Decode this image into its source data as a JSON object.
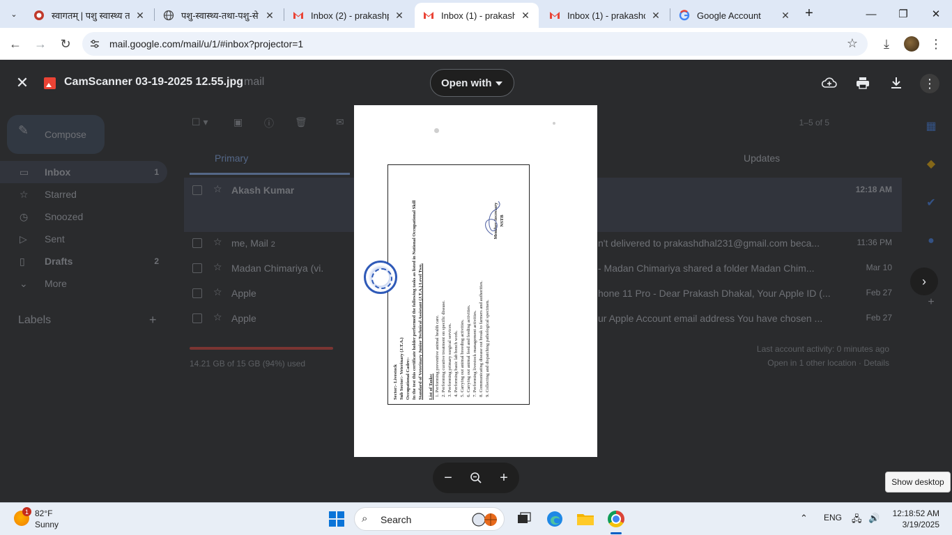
{
  "tabs": [
    {
      "title": "स्वागतम् | पशु स्वास्थ्य त"
    },
    {
      "title": "पशु-स्वास्थ्य-तथा-पशु-से"
    },
    {
      "title": "Inbox (2) - prakashpa"
    },
    {
      "title": "Inbox (1) - prakashdh"
    },
    {
      "title": "Inbox (1) - prakashdh"
    },
    {
      "title": "Google Account"
    }
  ],
  "address": {
    "url": "mail.google.com/mail/u/1/#inbox?projector=1"
  },
  "viewer": {
    "filename": "CamScanner 03-19-2025 12.55.jpg",
    "open_with": "Open with"
  },
  "gmail": {
    "compose": "Compose",
    "nav": [
      {
        "label": "Inbox",
        "count": "1"
      },
      {
        "label": "Starred",
        "count": ""
      },
      {
        "label": "Snoozed",
        "count": ""
      },
      {
        "label": "Sent",
        "count": ""
      },
      {
        "label": "Drafts",
        "count": "2"
      },
      {
        "label": "More",
        "count": ""
      }
    ],
    "labels_heading": "Labels",
    "search_hint": "mail",
    "pager": "1–5 of 5",
    "tab_primary": "Primary",
    "tab_updates": "Updates",
    "rows": [
      {
        "sender": "Akash Kumar",
        "count": "",
        "snippet": "",
        "date": "12:18 AM"
      },
      {
        "sender": "me, Mail",
        "count": "2",
        "snippet": "n't delivered to prakashdhal231@gmail.com beca...",
        "date": "11:36 PM"
      },
      {
        "sender": "Madan Chimariya (vi.",
        "count": "",
        "snippet": "- Madan Chimariya shared a folder Madan Chim...",
        "date": "Mar 10"
      },
      {
        "sender": "Apple",
        "count": "",
        "snippet": "hone 11 Pro - Dear Prakash Dhakal, Your Apple ID (...",
        "date": "Feb 27"
      },
      {
        "sender": "Apple",
        "count": "",
        "snippet": "ur Apple Account email address You have chosen ...",
        "date": "Feb 27"
      }
    ],
    "storage": "14.21 GB of 15 GB (94%) used",
    "storage_fraction": 0.94,
    "activity": "Last account activity: 0 minutes ago",
    "activity2": "Open in 1 other location · Details"
  },
  "document": {
    "sector": "Sector:-                Livestock",
    "sub_sector": "Sub Sector:-          Veterinary (J.T.A.)",
    "occupation": "Occupational Cadre:-",
    "statement": "In the test this certificate holder performed the following tasks as listed in National Occupational Skill",
    "standard": "Standard of Veterinary Junior Technical Assistant (J.T.A.) Level Two.",
    "list_heading": "List of Tasks:",
    "tasks": [
      "1.  Performing preventive animal health care.",
      "2.  Performing curative treatment on specific disease.",
      "3.  Performing primary surgical services.",
      "4.  Performing basic lab bench work.",
      "5.  Carrying out animal breeding activities.",
      "6.  Carrying out animal feed and feeding activities.",
      "7.  Performing livestock management activities.",
      "8.  Communicating disease out break to farmers and authorities.",
      "9.  Collecting and dispatching pathological specimen."
    ],
    "signatory": "Member Secretary",
    "signatory_org": "NSTB"
  },
  "taskbar": {
    "weather_temp": "82°F",
    "weather_desc": "Sunny",
    "weather_badge": "1",
    "search": "Search",
    "lang": "ENG",
    "time": "12:18:52 AM",
    "date": "3/19/2025",
    "tooltip": "Show desktop"
  }
}
